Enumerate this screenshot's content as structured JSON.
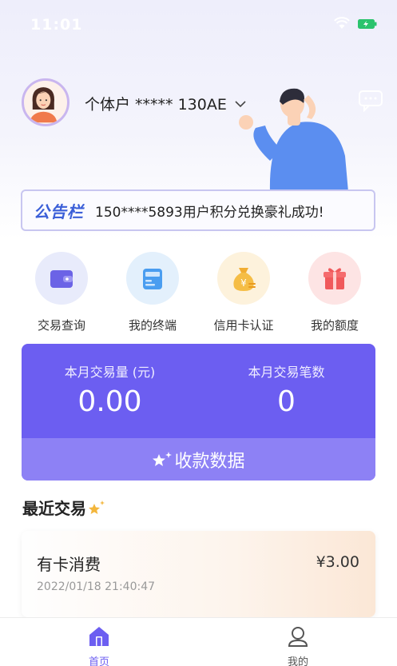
{
  "status_bar": {
    "time": "11:01"
  },
  "header": {
    "account_label": "个体户 ***** 130AE"
  },
  "notice": {
    "logo": "公告栏",
    "text": "150****5893用户积分兑换豪礼成功!"
  },
  "quick_actions": [
    {
      "label": "交易查询",
      "icon": "wallet-icon"
    },
    {
      "label": "我的终端",
      "icon": "terminal-icon"
    },
    {
      "label": "信用卡认证",
      "icon": "money-bag-icon"
    },
    {
      "label": "我的额度",
      "icon": "gift-icon"
    }
  ],
  "stats": {
    "volume_label": "本月交易量 (元)",
    "volume_value": "0.00",
    "count_label": "本月交易笔数",
    "count_value": "0",
    "collect_label": "收款数据"
  },
  "recent": {
    "title": "最近交易",
    "transactions": [
      {
        "title": "有卡消费",
        "amount": "¥3.00",
        "time": "2022/01/18 21:40:47"
      }
    ]
  },
  "tabs": [
    {
      "label": "首页",
      "active": true
    },
    {
      "label": "我的",
      "active": false
    }
  ],
  "colors": {
    "accent": "#6c5ef1",
    "accent_light": "#8d81f5",
    "notice_blue": "#3b5fd8",
    "tab_active": "#6c5ef1",
    "tab_inactive": "#555555"
  }
}
